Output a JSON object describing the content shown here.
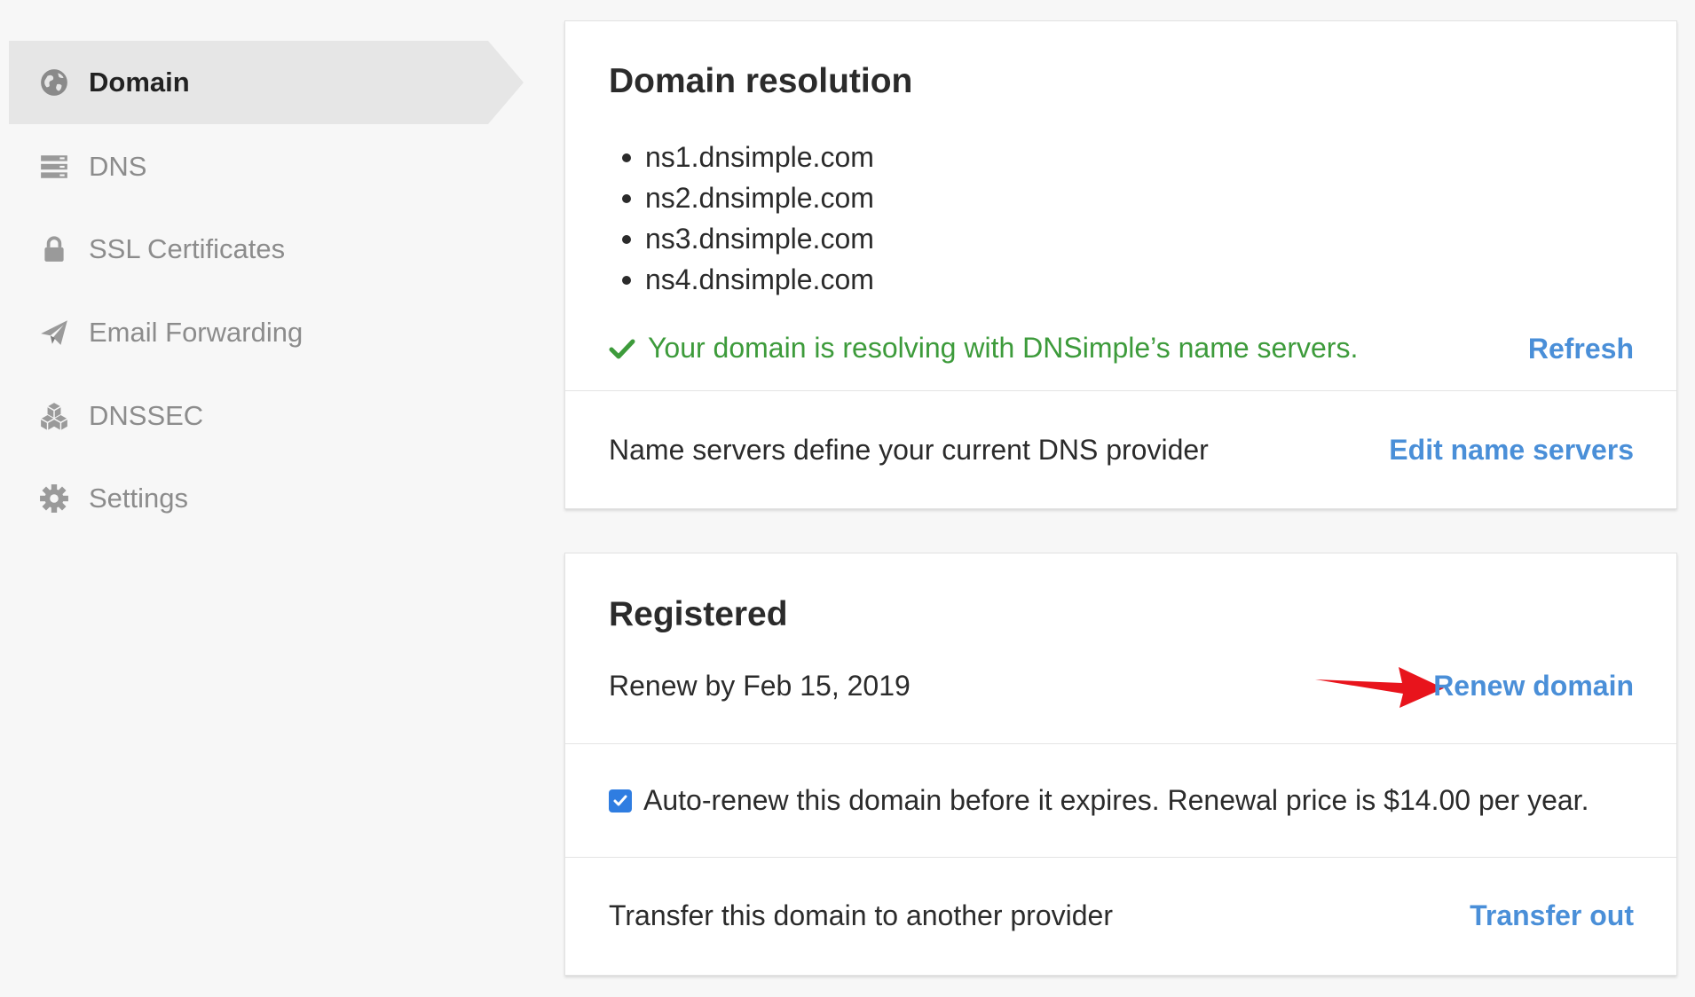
{
  "sidebar": {
    "items": [
      {
        "label": "Domain",
        "icon": "globe-icon",
        "active": true
      },
      {
        "label": "DNS",
        "icon": "server-icon",
        "active": false
      },
      {
        "label": "SSL Certificates",
        "icon": "lock-icon",
        "active": false
      },
      {
        "label": "Email Forwarding",
        "icon": "paper-plane-icon",
        "active": false
      },
      {
        "label": "DNSSEC",
        "icon": "cubes-icon",
        "active": false
      },
      {
        "label": "Settings",
        "icon": "gear-icon",
        "active": false
      }
    ]
  },
  "resolution": {
    "title": "Domain resolution",
    "name_servers": [
      "ns1.dnsimple.com",
      "ns2.dnsimple.com",
      "ns3.dnsimple.com",
      "ns4.dnsimple.com"
    ],
    "status": "Your domain is resolving with DNSimple’s name servers.",
    "refresh_label": "Refresh",
    "provider_text": "Name servers define your current DNS provider",
    "edit_label": "Edit name servers"
  },
  "registered": {
    "title": "Registered",
    "renew_text": "Renew by Feb 15, 2019",
    "renew_label": "Renew domain",
    "auto_renew_checked": true,
    "auto_renew_text": "Auto-renew this domain before it expires. Renewal price is $14.00 per year.",
    "transfer_text": "Transfer this domain to another provider",
    "transfer_label": "Transfer out"
  },
  "colors": {
    "link": "#4a8fd8",
    "success": "#3d9b3b",
    "checkbox": "#2f7de1",
    "annotation_arrow": "#e8141c"
  }
}
